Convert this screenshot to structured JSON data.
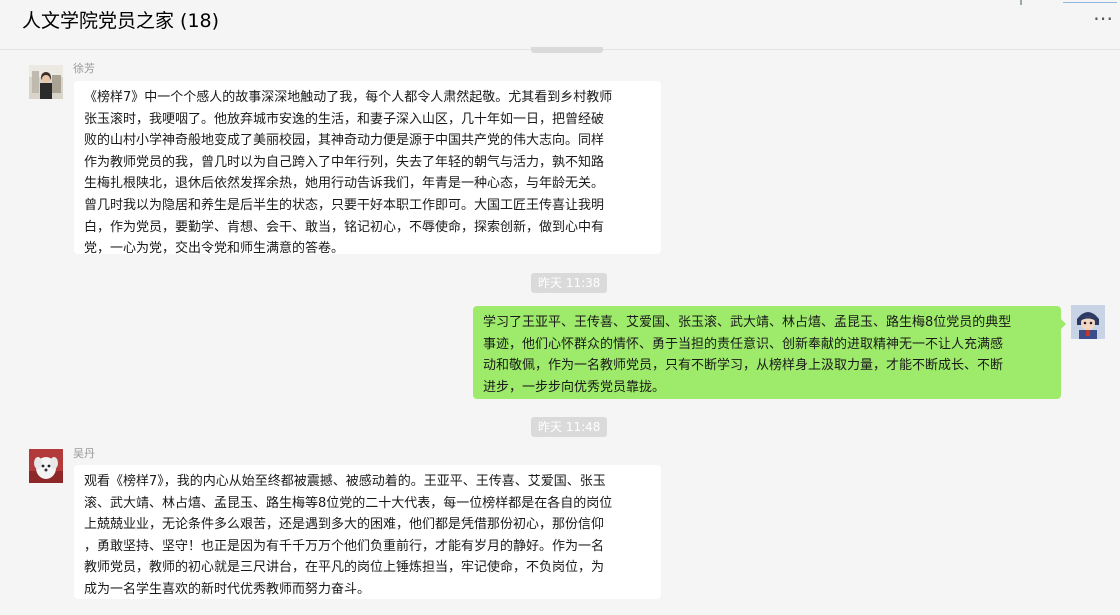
{
  "header": {
    "title": "人文学院党员之家 (18)",
    "more_icon": "⋯"
  },
  "messages": [
    {
      "sender": "徐芳",
      "side": "left",
      "avatar_icon": "person-photo-avatar",
      "lines": [
        "《榜样7》中一个个感人的故事深深地触动了我，每个人都令人肃然起敬。尤其看到乡村教师",
        "张玉滚时，我哽咽了。他放弃城市安逸的生活，和妻子深入山区，几十年如一日，把曾经破",
        "败的山村小学神奇般地变成了美丽校园，其神奇动力便是源于中国共产党的伟大志向。同样",
        "作为教师党员的我，曾几时以为自己跨入了中年行列，失去了年轻的朝气与活力，孰不知路",
        "生梅扎根陕北，退休后依然发挥余热，她用行动告诉我们，年青是一种心态，与年龄无关。",
        "曾几时我以为隐居和养生是后半生的状态，只要干好本职工作即可。大国工匠王传喜让我明",
        "白，作为党员，要勤学、肯想、会干、敢当，铭记初心，不辱使命，探索创新，做到心中有",
        "党，一心为党，交出令党和师生满意的答卷。"
      ]
    },
    {
      "time": "昨天 11:38"
    },
    {
      "sender": "",
      "side": "right",
      "avatar_icon": "anime-character-avatar",
      "lines": [
        "学习了王亚平、王传喜、艾爱国、张玉滚、武大靖、林占熺、孟昆玉、路生梅8位党员的典型",
        "事迹，他们心怀群众的情怀、勇于当担的责任意识、创新奉献的进取精神无一不让人充满感",
        "动和敬佩，作为一名教师党员，只有不断学习，从榜样身上汲取力量，才能不断成长、不断",
        "进步，一步步向优秀党员靠拢。"
      ]
    },
    {
      "time": "昨天 11:48"
    },
    {
      "sender": "吴丹",
      "side": "left",
      "avatar_icon": "white-dog-avatar",
      "lines": [
        "观看《榜样7》，我的内心从始至终都被震撼、被感动着的。王亚平、王传喜、艾爱国、张玉",
        "滚、武大靖、林占熺、孟昆玉、路生梅等8位党的二十大代表，每一位榜样都是在各自的岗位",
        "上兢兢业业，无论条件多么艰苦，还是遇到多大的困难，他们都是凭借那份初心，那份信仰",
        "，勇敢坚持、坚守！也正是因为有千千万万个他们负重前行，才能有岁月的静好。作为一名",
        "教师党员，教师的初心就是三尺讲台，在平凡的岗位上锤炼担当，牢记使命，不负岗位，为",
        "成为一名学生喜欢的新时代优秀教师而努力奋斗。"
      ]
    }
  ]
}
